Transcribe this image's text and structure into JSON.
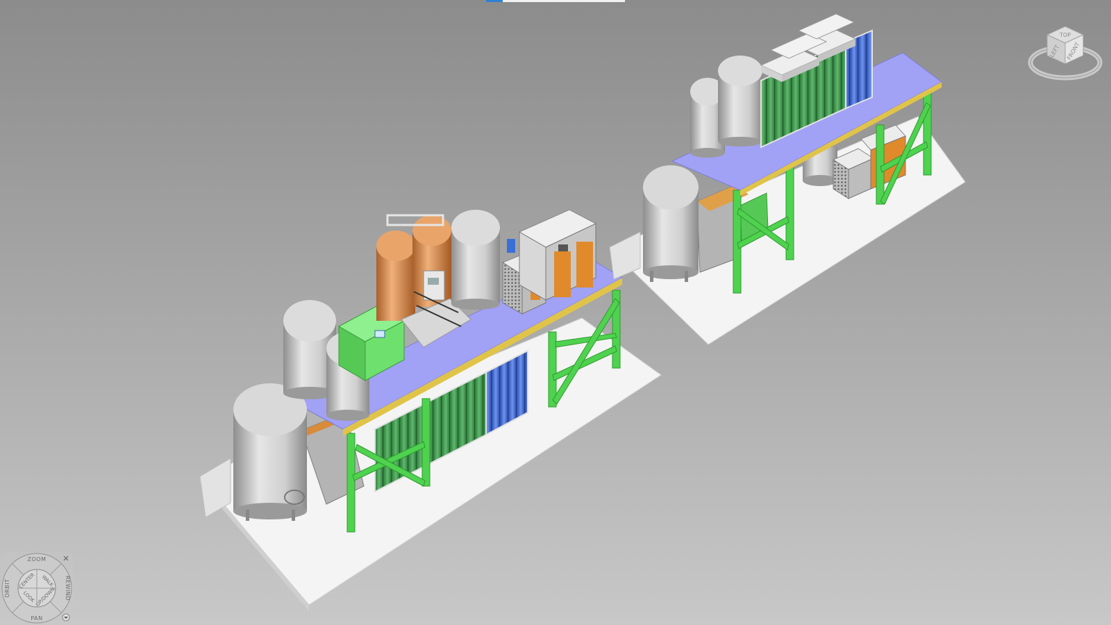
{
  "viewport": {
    "background_top": "#8c8c8c",
    "background_bottom": "#c8c8c8",
    "progress_indicator": {
      "fraction": 0.12,
      "color": "#2f7fd6"
    }
  },
  "viewcube": {
    "face_top": "TOP",
    "face_left": "LEFT",
    "face_front": "FRONT"
  },
  "navigation_wheel": {
    "zoom": "ZOOM",
    "orbit": "ORBIT",
    "rewind": "REWIND",
    "pan": "PAN",
    "center": "CENTER",
    "walk": "WALK",
    "look": "LOOK",
    "updown": "UP/DOWN",
    "close_icon": "close-icon",
    "menu_icon": "chevron-down-icon"
  },
  "model_colors": {
    "platform_deck": "#a1a1f6",
    "steel_frame": "#4fd24f",
    "tank": "#c9c9c9",
    "copper_tank": "#d98b4a",
    "base_slab": "#f4f4f4",
    "dryer_green": "#6ee06e",
    "cylinder_blue": "#3f6fd8",
    "cylinder_green": "#3a9a4a",
    "compressor_orange": "#e08a2c"
  }
}
